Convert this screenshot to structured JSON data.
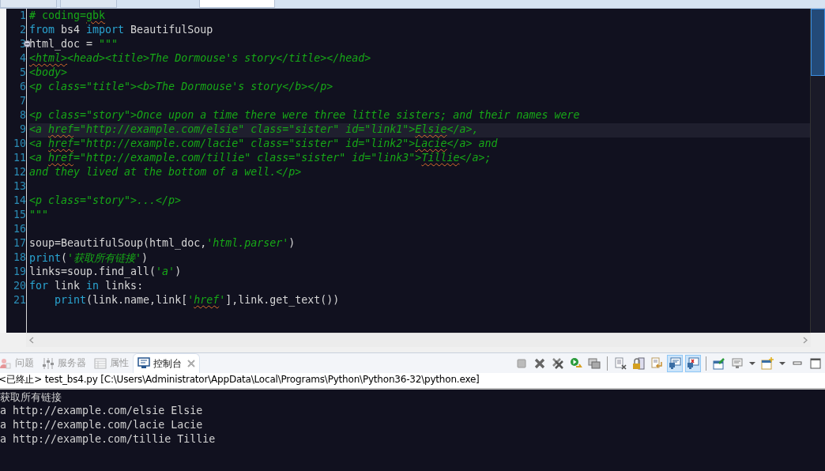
{
  "editor_tabs": [
    {
      "selected": false
    },
    {
      "selected": false
    },
    {
      "selected": true
    }
  ],
  "editor": {
    "lines": [
      {
        "number": "1",
        "tokens": [
          {
            "kind": "comment",
            "text": "# coding="
          },
          {
            "kind": "comment",
            "text": "gbk",
            "squiggle": true
          }
        ]
      },
      {
        "number": "2",
        "tokens": [
          {
            "kind": "keyword",
            "text": "from"
          },
          {
            "kind": "plain",
            "text": " bs4 "
          },
          {
            "kind": "keyword",
            "text": "import"
          },
          {
            "kind": "plain",
            "text": " BeautifulSoup"
          }
        ]
      },
      {
        "number": "3",
        "fold": true,
        "tokens": [
          {
            "kind": "plain",
            "text": "html_doc = "
          },
          {
            "kind": "string",
            "text": "\"\"\""
          }
        ]
      },
      {
        "number": "4",
        "tokens": [
          {
            "kind": "string",
            "text": "<html>",
            "squiggle": true
          },
          {
            "kind": "string",
            "text": "<head><title>The Dormouse's story</title></head>"
          }
        ]
      },
      {
        "number": "5",
        "tokens": [
          {
            "kind": "string",
            "text": "<body>"
          }
        ]
      },
      {
        "number": "6",
        "tokens": [
          {
            "kind": "string",
            "text": "<p class=\"title\"><b>The Dormouse's story</b></p>"
          }
        ]
      },
      {
        "number": "7"
      },
      {
        "number": "8",
        "tokens": [
          {
            "kind": "string",
            "text": "<p class=\"story\">Once upon a time there were three little sisters; and their names were"
          }
        ]
      },
      {
        "number": "9",
        "current": true,
        "tokens": [
          {
            "kind": "string",
            "text": "<a "
          },
          {
            "kind": "string",
            "text": "href",
            "squiggle": true
          },
          {
            "kind": "string",
            "text": "=\"http://example.com/elsie\" class=\"sister\" id=\"link1\">"
          },
          {
            "kind": "string",
            "text": "Elsie",
            "squiggle": true
          },
          {
            "kind": "string",
            "text": "</a>,"
          }
        ]
      },
      {
        "number": "10",
        "tokens": [
          {
            "kind": "string",
            "text": "<a "
          },
          {
            "kind": "string",
            "text": "href",
            "squiggle": true
          },
          {
            "kind": "string",
            "text": "=\"http://example.com/lacie\" class=\"sister\" id=\"link2\">"
          },
          {
            "kind": "string",
            "text": "Lacie",
            "squiggle": true
          },
          {
            "kind": "string",
            "text": "</a> and"
          }
        ]
      },
      {
        "number": "11",
        "tokens": [
          {
            "kind": "string",
            "text": "<a "
          },
          {
            "kind": "string",
            "text": "href",
            "squiggle": true
          },
          {
            "kind": "string",
            "text": "=\"http://example.com/tillie\" class=\"sister\" id=\"link3\">"
          },
          {
            "kind": "string",
            "text": "Tillie",
            "squiggle": true
          },
          {
            "kind": "string",
            "text": "</a>;"
          }
        ]
      },
      {
        "number": "12",
        "tokens": [
          {
            "kind": "string",
            "text": "and they lived at the bottom of a well.</p>"
          }
        ]
      },
      {
        "number": "13"
      },
      {
        "number": "14",
        "tokens": [
          {
            "kind": "string",
            "text": "<p class=\"story\">...</p>"
          }
        ]
      },
      {
        "number": "15",
        "tokens": [
          {
            "kind": "string",
            "text": "\"\"\""
          }
        ]
      },
      {
        "number": "16"
      },
      {
        "number": "17",
        "tokens": [
          {
            "kind": "plain",
            "text": "soup=BeautifulSoup(html_doc,"
          },
          {
            "kind": "string",
            "text": "'html.parser'"
          },
          {
            "kind": "plain",
            "text": ")"
          }
        ]
      },
      {
        "number": "18",
        "tokens": [
          {
            "kind": "keyword",
            "text": "print"
          },
          {
            "kind": "plain",
            "text": "("
          },
          {
            "kind": "string",
            "text": "'获取所有链接'"
          },
          {
            "kind": "plain",
            "text": ")"
          }
        ]
      },
      {
        "number": "19",
        "tokens": [
          {
            "kind": "plain",
            "text": "links=soup.find_all("
          },
          {
            "kind": "string",
            "text": "'a'"
          },
          {
            "kind": "plain",
            "text": ")"
          }
        ]
      },
      {
        "number": "20",
        "tokens": [
          {
            "kind": "keyword",
            "text": "for"
          },
          {
            "kind": "plain",
            "text": " link "
          },
          {
            "kind": "keyword",
            "text": "in"
          },
          {
            "kind": "plain",
            "text": " links:"
          }
        ]
      },
      {
        "number": "21",
        "tokens": [
          {
            "kind": "keyword",
            "text": "    print"
          },
          {
            "kind": "plain",
            "text": "(link.name,link["
          },
          {
            "kind": "string",
            "text": "'"
          },
          {
            "kind": "string",
            "text": "href",
            "squiggle": true
          },
          {
            "kind": "string",
            "text": "'"
          },
          {
            "kind": "plain",
            "text": "],link.get_text())"
          }
        ]
      }
    ]
  },
  "panel_tabs": [
    {
      "kind": "problems",
      "label": "问题",
      "selected": false
    },
    {
      "kind": "servers",
      "label": "服务器",
      "selected": false
    },
    {
      "kind": "properties",
      "label": "属性",
      "selected": false
    },
    {
      "kind": "console",
      "label": "控制台",
      "selected": true,
      "closable": true
    }
  ],
  "toolbar": [
    {
      "kind": "stop",
      "pressed": false
    },
    {
      "kind": "remove",
      "pressed": false
    },
    {
      "kind": "removeall",
      "pressed": false
    },
    {
      "kind": "relaunch",
      "pressed": false
    },
    {
      "kind": "stack",
      "pressed": false
    },
    {
      "kind": "sep"
    },
    {
      "kind": "clear",
      "pressed": false
    },
    {
      "kind": "lock",
      "pressed": false
    },
    {
      "kind": "wrap",
      "pressed": false
    },
    {
      "kind": "stdout",
      "pressed": true
    },
    {
      "kind": "stderr",
      "pressed": true
    },
    {
      "kind": "sep"
    },
    {
      "kind": "pin",
      "pressed": false
    },
    {
      "kind": "display",
      "pressed": false
    },
    {
      "kind": "dropdown",
      "pressed": false
    },
    {
      "kind": "newconsole",
      "pressed": false
    },
    {
      "kind": "dropdown",
      "pressed": false
    },
    {
      "kind": "minimize",
      "pressed": false
    },
    {
      "kind": "maximize",
      "pressed": false
    }
  ],
  "console": {
    "status": "<已终止> test_bs4.py [C:\\Users\\Administrator\\AppData\\Local\\Programs\\Python\\Python36-32\\python.exe]",
    "output": [
      "获取所有链接",
      "a http://example.com/elsie Elsie",
      "a http://example.com/lacie Lacie",
      "a http://example.com/tillie Tillie"
    ]
  }
}
